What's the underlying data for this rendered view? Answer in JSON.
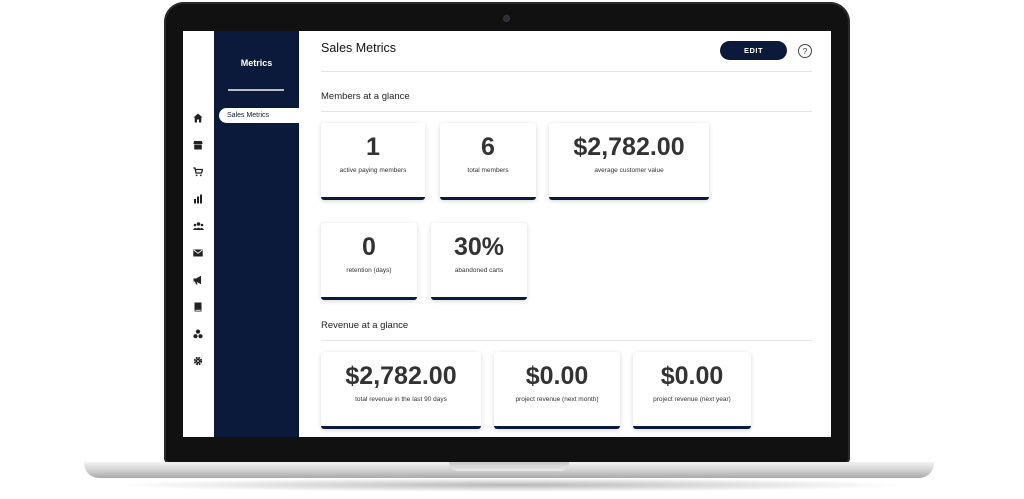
{
  "nav": {
    "title": "Metrics",
    "items": [
      {
        "label": "Sales Metrics",
        "active": true
      }
    ]
  },
  "rail_icons": [
    "home-icon",
    "store-icon",
    "cart-icon",
    "bar-chart-icon",
    "users-icon",
    "mail-icon",
    "megaphone-icon",
    "book-icon",
    "cluster-icon",
    "gear-icon"
  ],
  "header": {
    "title": "Sales Metrics",
    "edit_label": "EDIT",
    "help_label": "?"
  },
  "members": {
    "title": "Members at a glance",
    "cards": [
      {
        "value": "1",
        "label": "active paying members"
      },
      {
        "value": "6",
        "label": "total members"
      },
      {
        "value": "$2,782.00",
        "label": "average customer value"
      },
      {
        "value": "0",
        "label": "retention (days)"
      },
      {
        "value": "30%",
        "label": "abandoned carts"
      }
    ]
  },
  "revenue": {
    "title": "Revenue at a glance",
    "cards": [
      {
        "value": "$2,782.00",
        "label": "total revenue in the last 90 days"
      },
      {
        "value": "$0.00",
        "label": "project revenue (next month)"
      },
      {
        "value": "$0.00",
        "label": "project revenue (next year)"
      }
    ]
  },
  "colors": {
    "navy": "#0b1a3b",
    "card_text": "#333333",
    "background": "#ffffff"
  }
}
